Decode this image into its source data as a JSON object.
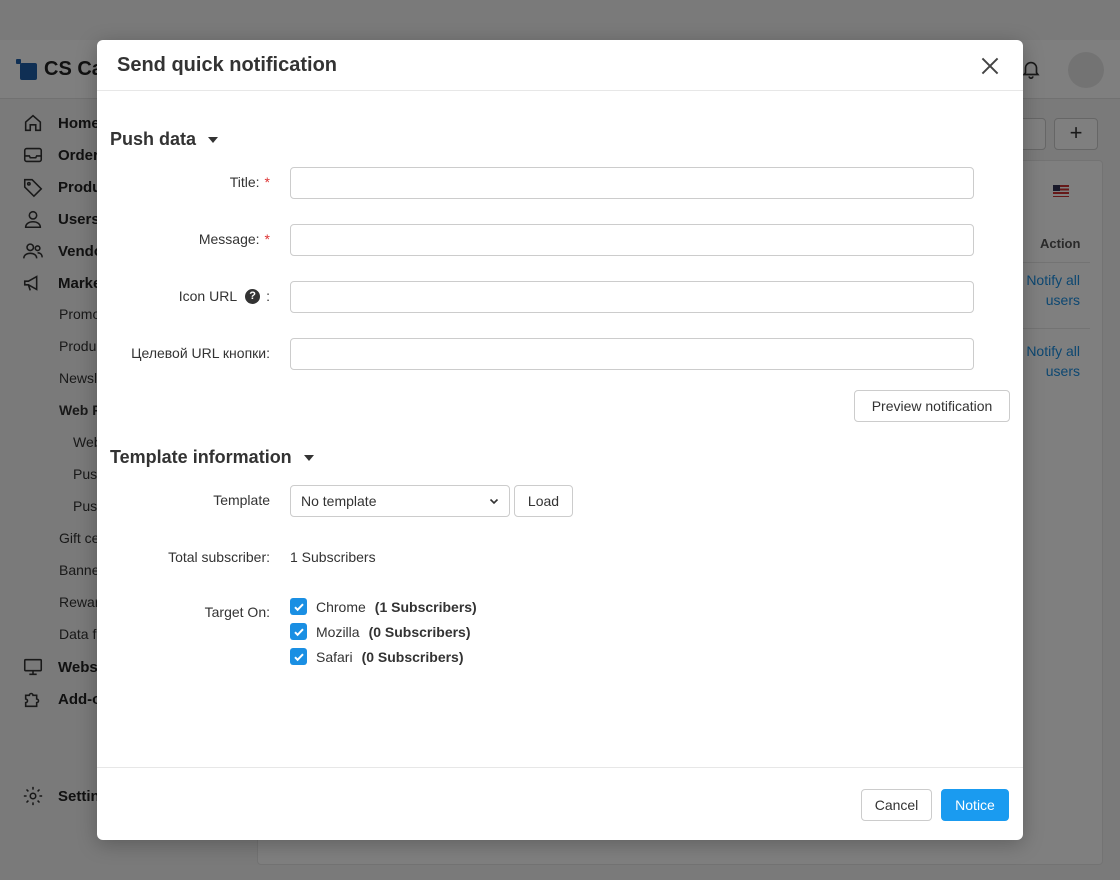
{
  "background": {
    "logo_text": "CS Ca",
    "sidebar": {
      "items": [
        {
          "label": "Home",
          "icon": "home-icon"
        },
        {
          "label": "Order",
          "icon": "inbox-icon"
        },
        {
          "label": "Produ",
          "icon": "tag-icon"
        },
        {
          "label": "Users",
          "icon": "user-icon"
        },
        {
          "label": "Vendo",
          "icon": "users-icon"
        },
        {
          "label": "Marke",
          "icon": "megaphone-icon"
        }
      ],
      "sub_items": [
        "Promo",
        "Produ",
        "Newsl",
        "Web P"
      ],
      "sub_sub_items": [
        "Web",
        "Push",
        "Push"
      ],
      "more_sub_items": [
        "Gift ce",
        "Banne",
        "Rewar",
        "Data f"
      ],
      "bottom_items": [
        {
          "label": "Websi",
          "icon": "monitor-icon"
        },
        {
          "label": "Add-o",
          "icon": "puzzle-icon"
        }
      ],
      "settings": {
        "label": "Settin",
        "icon": "gear-icon"
      }
    },
    "table": {
      "action_header": "Action",
      "links": [
        "Notify all users",
        "Notify all users"
      ]
    },
    "plus_label": "+"
  },
  "modal": {
    "title": "Send quick notification",
    "push_section": {
      "title": "Push data",
      "fields": {
        "title": {
          "label": "Title:",
          "required": "*",
          "value": ""
        },
        "message": {
          "label": "Message:",
          "required": "*",
          "value": ""
        },
        "icon_url": {
          "label": "Icon URL",
          "suffix": ":",
          "help": "?",
          "value": ""
        },
        "button_url": {
          "label": "Целевой URL кнопки:",
          "value": ""
        }
      },
      "preview_button": "Preview notification"
    },
    "template_section": {
      "title": "Template information",
      "template_label": "Template",
      "template_selected": "No template",
      "load_button": "Load",
      "total_label": "Total subscriber:",
      "total_value": "1 Subscribers",
      "target_label": "Target On:",
      "targets": [
        {
          "browser": "Chrome",
          "count": "(1 Subscribers)",
          "checked": true
        },
        {
          "browser": "Mozilla",
          "count": "(0 Subscribers)",
          "checked": true
        },
        {
          "browser": "Safari",
          "count": "(0 Subscribers)",
          "checked": true
        }
      ]
    },
    "footer": {
      "cancel": "Cancel",
      "submit": "Notice"
    }
  },
  "colors": {
    "primary": "#1a9bf0",
    "link": "#1a8fe3",
    "required": "#dd3333"
  }
}
